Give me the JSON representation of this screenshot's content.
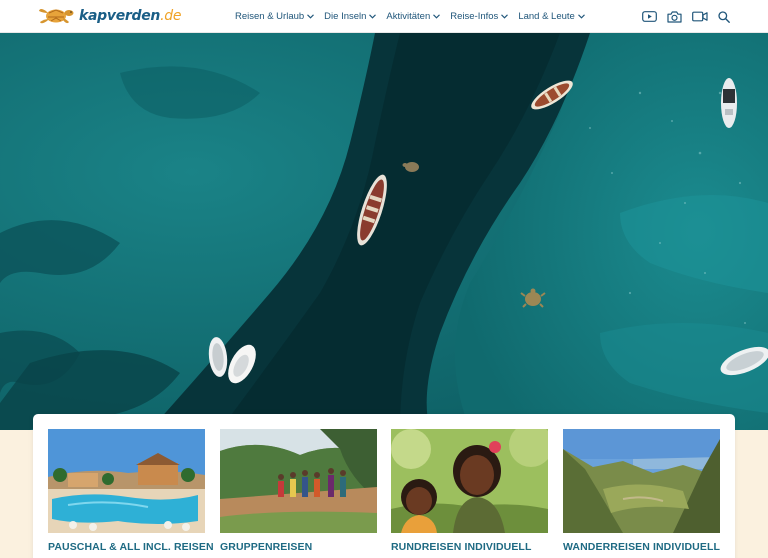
{
  "header": {
    "logo_text": "kapverden",
    "logo_tld": ".de",
    "nav": [
      {
        "label": "Reisen & Urlaub"
      },
      {
        "label": "Die Inseln"
      },
      {
        "label": "Aktivitäten"
      },
      {
        "label": "Reise-Infos"
      },
      {
        "label": "Land & Leute"
      }
    ],
    "tools": [
      "youtube-icon",
      "camera-icon",
      "video-icon",
      "search-icon"
    ]
  },
  "colors": {
    "brand_blue": "#1a5e86",
    "brand_orange": "#f0a224",
    "ocean": "#137378",
    "card_title": "#1e6a83",
    "page_background": "#fbf1df"
  },
  "cards": [
    {
      "title": "PAUSCHAL & ALL INCL. REISEN"
    },
    {
      "title": "GRUPPENREISEN"
    },
    {
      "title": "RUNDREISEN INDIVIDUELL"
    },
    {
      "title": "WANDERREISEN INDIVIDUELL"
    }
  ]
}
